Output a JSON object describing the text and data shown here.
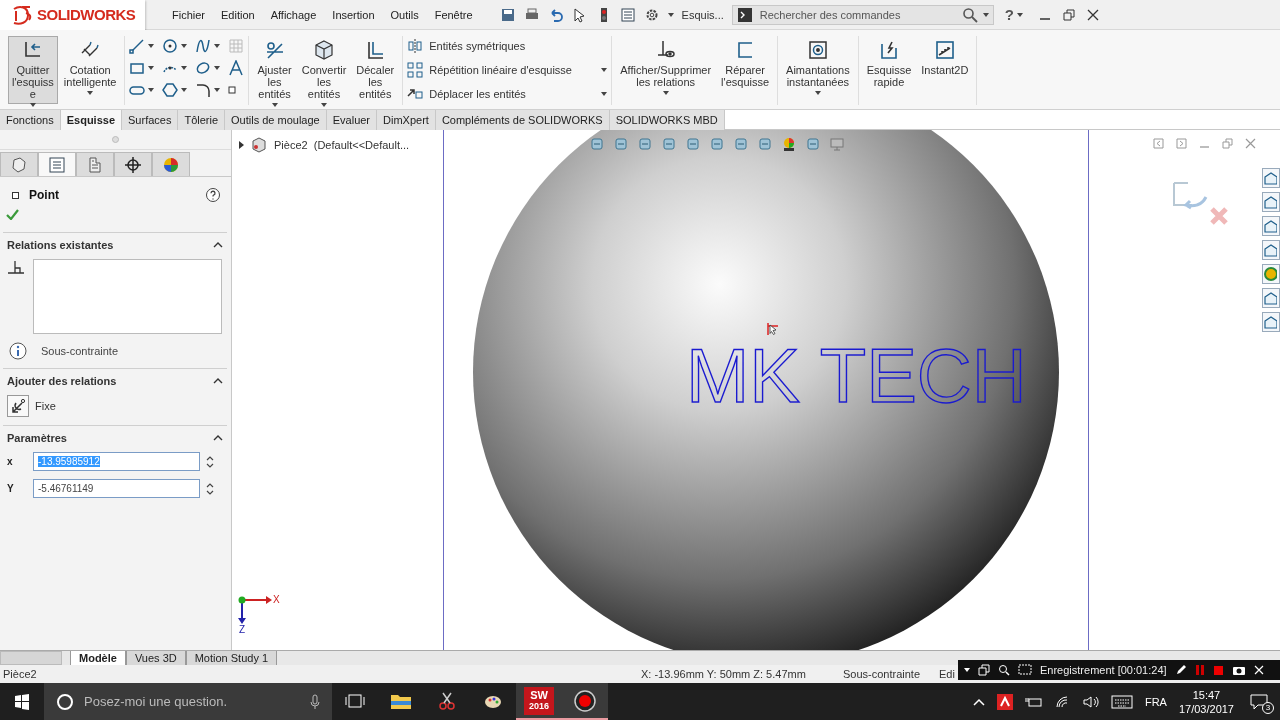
{
  "app": {
    "name": "SOLIDWORKS"
  },
  "menu": [
    "Fichier",
    "Edition",
    "Affichage",
    "Insertion",
    "Outils",
    "Fenêtre"
  ],
  "toolbar": {
    "mode_label": "Esquis...",
    "search": {
      "placeholder": "Rechercher des commandes"
    },
    "help": "?"
  },
  "ribbon_groups": [
    {
      "kind": "large",
      "items": [
        {
          "label": "Quitter\nl'esquiss\ne",
          "pressed": true,
          "dropdown": true
        },
        {
          "label": "Cotation\nintelligente",
          "pressed": false,
          "dropdown": true
        }
      ]
    },
    {
      "kind": "tools"
    },
    {
      "kind": "large",
      "items": [
        {
          "label": "Ajuster\nles\nentités",
          "pressed": false,
          "dropdown": true
        },
        {
          "label": "Convertir\nles\nentités",
          "pressed": false,
          "dropdown": true
        },
        {
          "label": "Décaler\nles\nentités",
          "pressed": false,
          "dropdown": false
        }
      ]
    },
    {
      "kind": "list",
      "items": [
        {
          "label": "Entités symétriques",
          "dropdown": false
        },
        {
          "label": "Répétition linéaire d'esquisse",
          "dropdown": true
        },
        {
          "label": "Déplacer les entités",
          "dropdown": true
        }
      ]
    },
    {
      "kind": "large",
      "items": [
        {
          "label": "Afficher/Supprimer\nles relations",
          "pressed": false,
          "dropdown": true
        },
        {
          "label": "Réparer\nl'esquisse",
          "pressed": false,
          "dropdown": false
        }
      ]
    },
    {
      "kind": "large",
      "items": [
        {
          "label": "Aimantations\ninstantanées",
          "pressed": false,
          "dropdown": true
        }
      ]
    },
    {
      "kind": "large",
      "items": [
        {
          "label": "Esquisse\nrapide",
          "pressed": false,
          "dropdown": false
        },
        {
          "label": "Instant2D",
          "pressed": false,
          "dropdown": false
        }
      ]
    }
  ],
  "command_tabs": [
    {
      "label": "Fonctions",
      "selected": false
    },
    {
      "label": "Esquisse",
      "selected": true
    },
    {
      "label": "Surfaces",
      "selected": false
    },
    {
      "label": "Tôlerie",
      "selected": false
    },
    {
      "label": "Outils de moulage",
      "selected": false
    },
    {
      "label": "Evaluer",
      "selected": false
    },
    {
      "label": "DimXpert",
      "selected": false
    },
    {
      "label": "Compléments de SOLIDWORKS",
      "selected": false
    },
    {
      "label": "SOLIDWORKS MBD",
      "selected": false
    }
  ],
  "property_manager": {
    "tabs": [
      {
        "selected": false
      },
      {
        "selected": true
      },
      {
        "selected": false
      },
      {
        "selected": false
      },
      {
        "selected": false
      }
    ],
    "title": "Point",
    "existing_relations": {
      "title": "Relations existantes",
      "expanded": true,
      "status": "Sous-contrainte"
    },
    "add_relations": {
      "title": "Ajouter des relations",
      "expanded": true,
      "options": [
        "Fixe"
      ]
    },
    "parameters": {
      "title": "Paramètres",
      "expanded": true,
      "fields": [
        {
          "axis": "x",
          "value": "-13.95985912",
          "highlighted": true
        },
        {
          "axis": "Y",
          "value": "-5.46761149",
          "highlighted": false
        }
      ]
    }
  },
  "tree": {
    "root": {
      "label": "Pièce2  (Default<<Default...",
      "expanded": false
    }
  },
  "viewport": {
    "sketch_text": "MK TECH",
    "triad": {
      "x": "X",
      "z": "Z"
    }
  },
  "bottom_tabs": [
    {
      "label": "Modèle",
      "selected": true
    },
    {
      "label": "Vues 3D",
      "selected": false
    },
    {
      "label": "Motion Study 1",
      "selected": false
    }
  ],
  "status_bar": {
    "document": "Pièce2",
    "coordinates": "X: -13.96mm Y: 50mm Z: 5.47mm",
    "sketch_status": "Sous-contrainte",
    "mode": "Edi"
  },
  "recorder": {
    "status": "Enregistrement [00:01:24]"
  },
  "taskbar": {
    "search": {
      "placeholder": "Posez-moi une question."
    },
    "apps": [
      {
        "selected": false
      },
      {
        "selected": false
      },
      {
        "selected": false
      },
      {
        "selected": false
      },
      {
        "selected": true
      },
      {
        "selected": true
      }
    ],
    "sw_icon": {
      "text": "SW",
      "version": "2016"
    },
    "tray": {
      "language": "FRA",
      "time": "15:47",
      "date": "17/03/2017",
      "notifications": "3"
    }
  }
}
